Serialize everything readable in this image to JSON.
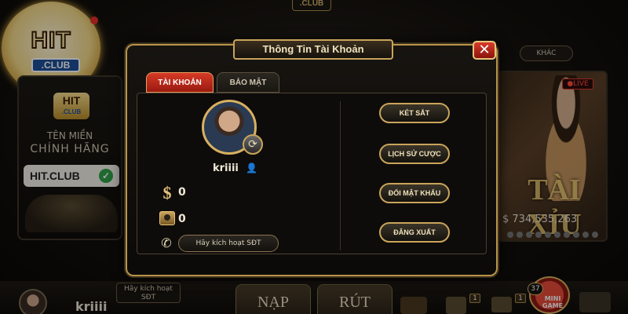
{
  "background": {
    "top_club": ".CLUB",
    "logo": {
      "hit": "HIT",
      "club": ".CLUB"
    },
    "left_panel": {
      "mini_logo_hit": "HIT",
      "mini_logo_club": ".CLUB",
      "domain_line1": "TÊN MIỀN",
      "domain_line2": "CHÍNH HÃNG",
      "domain_name": "HIT.CLUB"
    },
    "right_panel": {
      "live": "●LIVE",
      "game_name": "TÀI XỈU",
      "jackpot": "$ 734,535,263"
    },
    "khac_button": "KHÁC"
  },
  "bottom_bar": {
    "username": "kriiii",
    "phone_hint": "Hãy kích hoạt SĐT",
    "nap": "NẠP",
    "rut": "RÚT",
    "badge_gift": "1",
    "badge_mail": "1",
    "minigame_count": "37",
    "minigame_label": "MINI GAME"
  },
  "modal": {
    "title": "Thông Tin Tài Khoản",
    "close_symbol": "✕",
    "tabs": [
      {
        "label": "TÀI KHOẢN",
        "active": true
      },
      {
        "label": "BẢO MẬT",
        "active": false
      }
    ],
    "account": {
      "username": "kriiii",
      "balance": "0",
      "safe_balance": "0",
      "phone_button": "Hãy kích hoạt SĐT"
    },
    "actions": [
      {
        "label": "KÉT SẮT"
      },
      {
        "label": "LỊCH SỬ CƯỢC"
      },
      {
        "label": "ĐỔI MẬT KHẨU"
      },
      {
        "label": "ĐĂNG XUẤT"
      }
    ]
  },
  "colors": {
    "gold": "#c9a45a",
    "tab_active": "#d63a26",
    "close_red": "#d83a2a",
    "background": "#0c0a08"
  },
  "icons": [
    "dollar-icon",
    "safe-icon",
    "phone-icon",
    "swap-avatar-icon",
    "user-icon",
    "close-icon",
    "check-icon"
  ]
}
